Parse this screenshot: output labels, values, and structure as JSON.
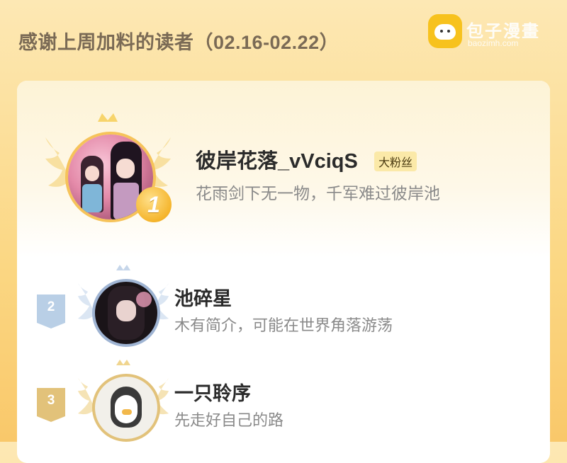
{
  "page": {
    "title": "感谢上周加料的读者（02.16-02.22）"
  },
  "watermark": {
    "text": "包子漫畫",
    "sub": "baozimh.com"
  },
  "ranking": [
    {
      "rank": "1",
      "name": "彼岸花落_vVciqS",
      "badge": "大粉丝",
      "bio": "花雨剑下无一物，千军难过彼岸池"
    },
    {
      "rank": "2",
      "name": "池碎星",
      "bio": "木有简介，可能在世界角落游荡"
    },
    {
      "rank": "3",
      "name": "一只聆序",
      "bio": "先走好自己的路"
    }
  ],
  "colors": {
    "gold": "#f5b52d",
    "silver": "#b9cfe6",
    "bronze": "#e2c27a",
    "background": "#fbd783"
  }
}
